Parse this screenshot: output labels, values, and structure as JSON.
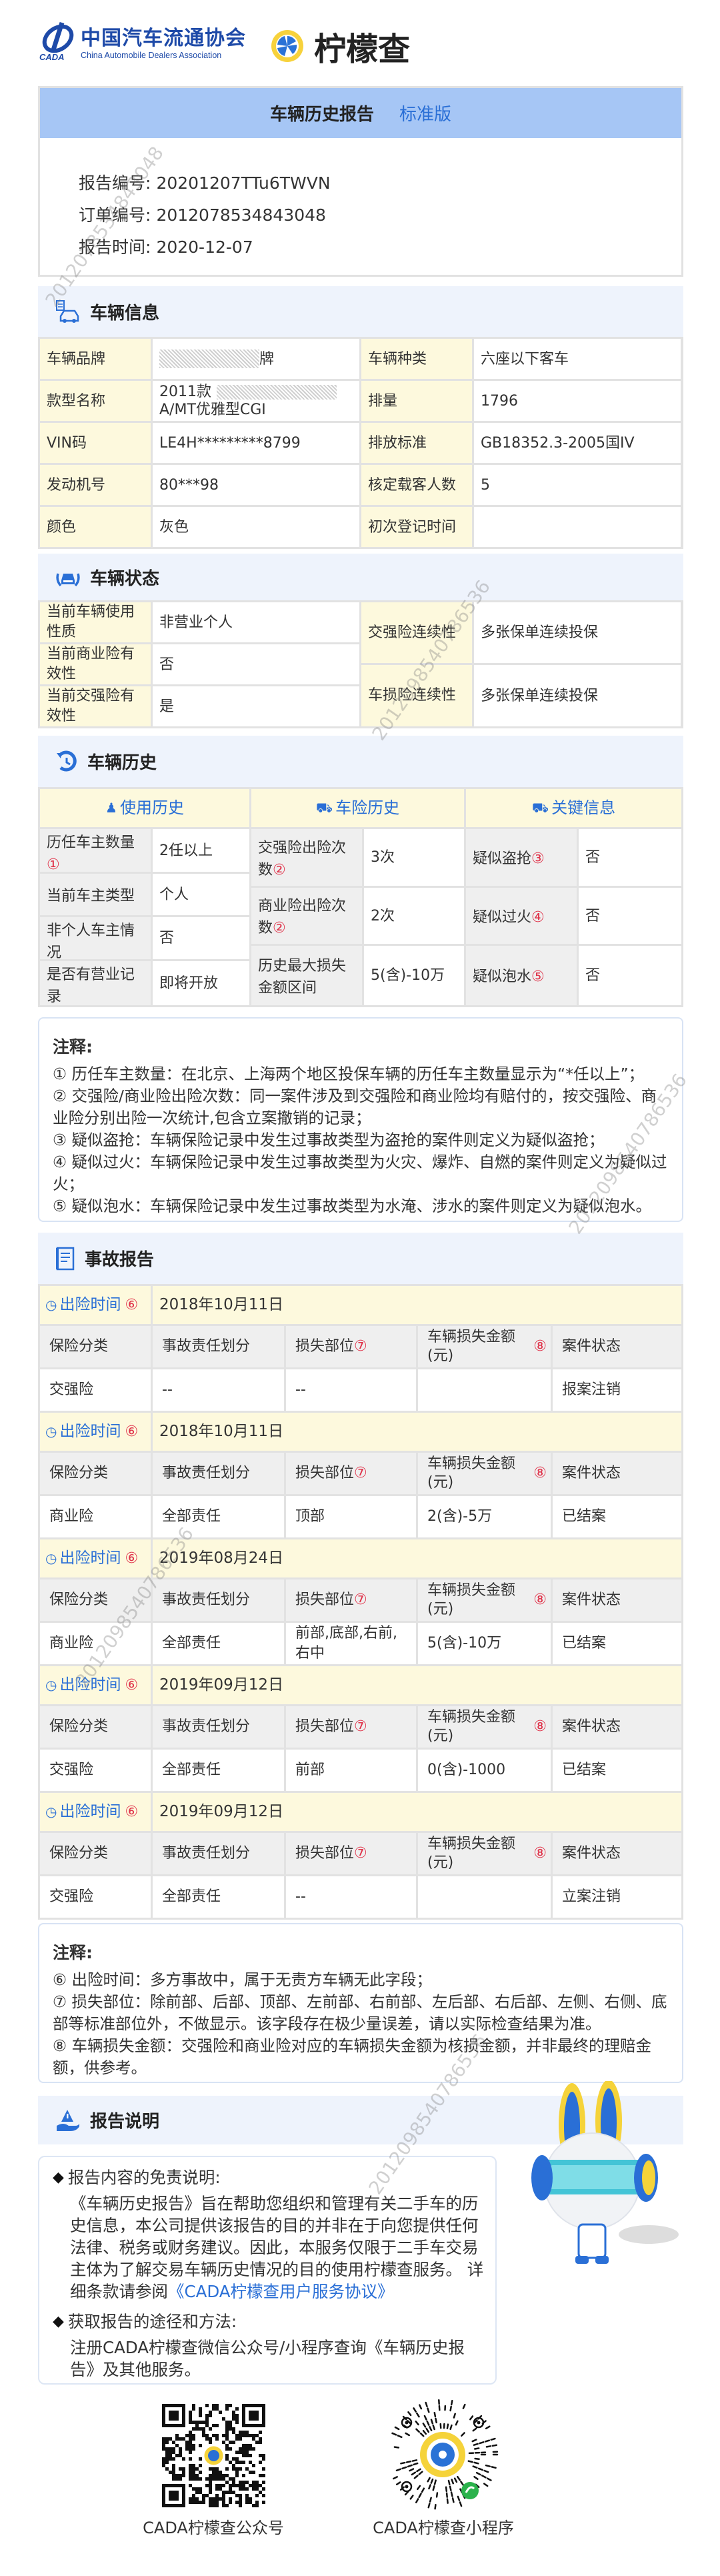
{
  "header": {
    "cada_cn": "中国汽车流通协会",
    "cada_en": "China Automobile Dealers Association",
    "cada_mark": "CADA",
    "brand": "柠檬查"
  },
  "report": {
    "title": "车辆历史报告",
    "edition": "标准版",
    "fields": [
      {
        "label": "报告编号:",
        "value": "20201207TTu6TWVN"
      },
      {
        "label": "订单编号:",
        "value": "2012078534843048"
      },
      {
        "label": "报告时间:",
        "value": "2020-12-07"
      }
    ]
  },
  "vehicle_info": {
    "title": "车辆信息",
    "rows": [
      [
        "车辆品牌",
        "牌",
        "车辆种类",
        "六座以下客车"
      ],
      [
        "款型名称",
        "2011款",
        "排量",
        "1796"
      ],
      [
        "VIN码",
        "LE4H*********8799",
        "排放标准",
        "GB18352.3-2005国IV"
      ],
      [
        "发动机号",
        "80***98",
        "核定载客人数",
        "5"
      ],
      [
        "颜色",
        "灰色",
        "初次登记时间",
        ""
      ]
    ],
    "model_line2": "A/MT优雅型CGI"
  },
  "vehicle_status": {
    "title": "车辆状态",
    "left": [
      [
        "当前车辆使用性质",
        "非营业个人"
      ],
      [
        "当前商业险有效性",
        "否"
      ],
      [
        "当前交强险有效性",
        "是"
      ]
    ],
    "right": [
      [
        "交强险连续性",
        "多张保单连续投保"
      ],
      [
        "车损险连续性",
        "多张保单连续投保"
      ]
    ]
  },
  "history": {
    "title": "车辆历史",
    "tabs": [
      "使用历史",
      "车险历史",
      "关键信息"
    ],
    "usage": [
      [
        "历任车主数量",
        "①",
        "2任以上"
      ],
      [
        "当前车主类型",
        "",
        "个人"
      ],
      [
        "非个人车主情况",
        "",
        "否"
      ],
      [
        "是否有营业记录",
        "",
        "即将开放"
      ]
    ],
    "insurance": [
      [
        "交强险出险次数",
        "②",
        "3次"
      ],
      [
        "商业险出险次数",
        "②",
        "2次"
      ],
      [
        "历史最大损失金额区间",
        "",
        "5(含)-10万"
      ]
    ],
    "key": [
      [
        "疑似盗抢",
        "③",
        "否"
      ],
      [
        "疑似过火",
        "④",
        "否"
      ],
      [
        "疑似泡水",
        "⑤",
        "否"
      ]
    ]
  },
  "notes1": {
    "title": "注释:",
    "lines": [
      "① 历任车主数量：在北京、上海两个地区投保车辆的历任车主数量显示为“*任以上”；",
      "② 交强险/商业险出险次数：同一案件涉及到交强险和商业险均有赔付的，按交强险、商业险分别出险一次统计,包含立案撤销的记录；",
      "③ 疑似盗抢：车辆保险记录中发生过事故类型为盗抢的案件则定义为疑似盗抢；",
      "④ 疑似过火：车辆保险记录中发生过事故类型为火灾、爆炸、自燃的案件则定义为疑似过火；",
      "⑤ 疑似泡水：车辆保险记录中发生过事故类型为水淹、涉水的案件则定义为疑似泡水。"
    ]
  },
  "accidents": {
    "title": "事故报告",
    "time_label": "出险时间",
    "time_mark": "⑥",
    "headers": [
      "保险分类",
      "事故责任划分",
      "损失部位",
      "车辆损失金额(元)",
      "案件状态"
    ],
    "header_marks": [
      "",
      "",
      "⑦",
      "⑧",
      ""
    ],
    "records": [
      {
        "date": "2018年10月11日",
        "cells": [
          "交强险",
          "--",
          "--",
          "",
          "报案注销"
        ]
      },
      {
        "date": "2018年10月11日",
        "cells": [
          "商业险",
          "全部责任",
          "顶部",
          "2(含)-5万",
          "已结案"
        ]
      },
      {
        "date": "2019年08月24日",
        "cells": [
          "商业险",
          "全部责任",
          "前部,底部,右前,右中",
          "5(含)-10万",
          "已结案"
        ]
      },
      {
        "date": "2019年09月12日",
        "cells": [
          "交强险",
          "全部责任",
          "前部",
          "0(含)-1000",
          "已结案"
        ]
      },
      {
        "date": "2019年09月12日",
        "cells": [
          "交强险",
          "全部责任",
          "--",
          "",
          "立案注销"
        ]
      }
    ]
  },
  "notes2": {
    "title": "注释:",
    "lines": [
      "⑥ 出险时间：多方事故中，属于无责方车辆无此字段；",
      "⑦ 损失部位：除前部、后部、顶部、左前部、右前部、左后部、右后部、左侧、右侧、底部等标准部位外，不做显示。该字段存在极少量误差，请以实际检查结果为准。",
      "⑧ 车辆损失金额：交强险和商业险对应的车辆损失金额为核损金额，并非最终的理赔金额，供参考。"
    ]
  },
  "explain": {
    "title": "报告说明",
    "disclaimer_title": "报告内容的免责说明:",
    "disclaimer_text": "《车辆历史报告》旨在帮助您组织和管理有关二手车的历史信息，本公司提供该报告的目的并非在于向您提供任何法律、税务或财务建议。因此，本服务仅限于二手车交易主体为了解交易车辆历史情况的目的使用柠檬查服务。 详细条款请参阅",
    "agreement_link": "《CADA柠檬查用户服务协议》",
    "method_title": "获取报告的途径和方法:",
    "method_text": "注册CADA柠檬查微信公众号/小程序查询《车辆历史报告》及其他服务。"
  },
  "qr": {
    "official_account": "CADA柠檬查公众号",
    "mini_program": "CADA柠檬查小程序"
  },
  "watermarks": [
    "2012078534843048",
    "2012098540786536"
  ],
  "colors": {
    "accent": "#2a6fd6",
    "band": "#a6c6f5",
    "section_bg": "#eef3fc",
    "label_bg": "#fdf9dd",
    "mark": "#e0334a"
  }
}
